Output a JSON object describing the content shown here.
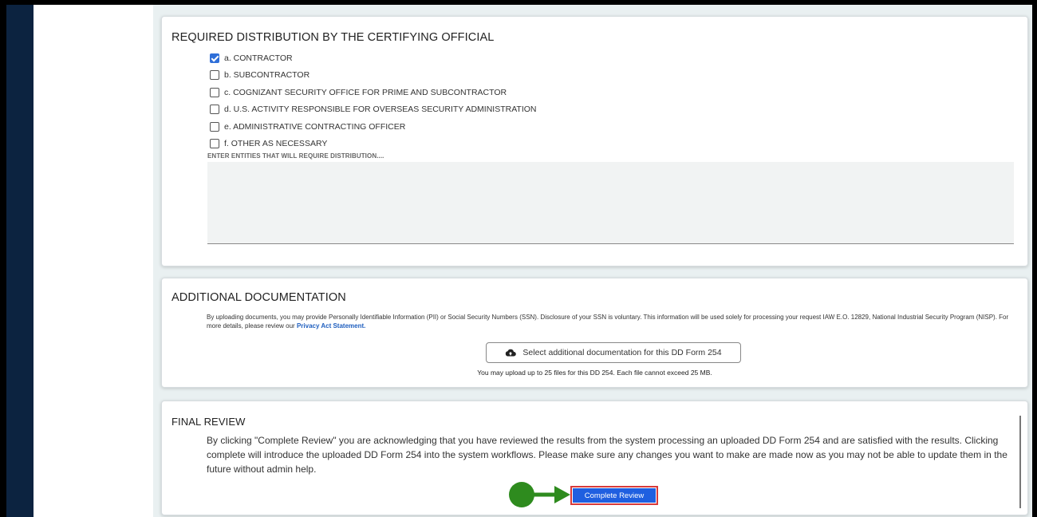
{
  "distribution": {
    "title": "REQUIRED DISTRIBUTION BY THE CERTIFYING OFFICIAL",
    "options": [
      {
        "label": "a. CONTRACTOR",
        "checked": true
      },
      {
        "label": "b. SUBCONTRACTOR",
        "checked": false
      },
      {
        "label": "c. COGNIZANT SECURITY OFFICE FOR PRIME AND SUBCONTRACTOR",
        "checked": false
      },
      {
        "label": "d. U.S. ACTIVITY RESPONSIBLE FOR OVERSEAS SECURITY ADMINISTRATION",
        "checked": false
      },
      {
        "label": "e. ADMINISTRATIVE CONTRACTING OFFICER",
        "checked": false
      },
      {
        "label": "f. OTHER AS NECESSARY",
        "checked": false
      }
    ],
    "entities_label": "ENTER ENTITIES THAT WILL REQUIRE DISTRIBUTION....",
    "entities_value": ""
  },
  "documentation": {
    "title": "ADDITIONAL DOCUMENTATION",
    "notice": "By uploading documents, you may provide Personally Identifiable Information (PII) or Social Security Numbers (SSN). Disclosure of your SSN is voluntary. This information will be used solely for processing your request IAW E.O. 12829, National Industrial Security Program (NISP). For more details, please review our",
    "privacy_link": "Privacy Act Statement.",
    "upload_button": "Select additional documentation for this DD Form 254",
    "upload_note": "You may upload up to 25 files for this DD 254.  Each file cannot exceed 25 MB."
  },
  "final_review": {
    "title": "FINAL REVIEW",
    "text": "By clicking \"Complete Review\" you are acknowledging that you have reviewed the results from the system processing an uploaded DD Form 254 and are satisfied with the results. Clicking complete will introduce the uploaded DD Form 254 into the system workflows. Please make sure any changes you want to make are made now as you may not be able to update them in the future without admin help.",
    "button": "Complete Review"
  },
  "colors": {
    "nav": "#0c2340",
    "accent": "#1f5fe0",
    "highlight": "#d83a3a",
    "pointer": "#2e8b1e"
  },
  "icons": {
    "upload": "cloud-upload-icon",
    "check": "checkmark-icon"
  }
}
